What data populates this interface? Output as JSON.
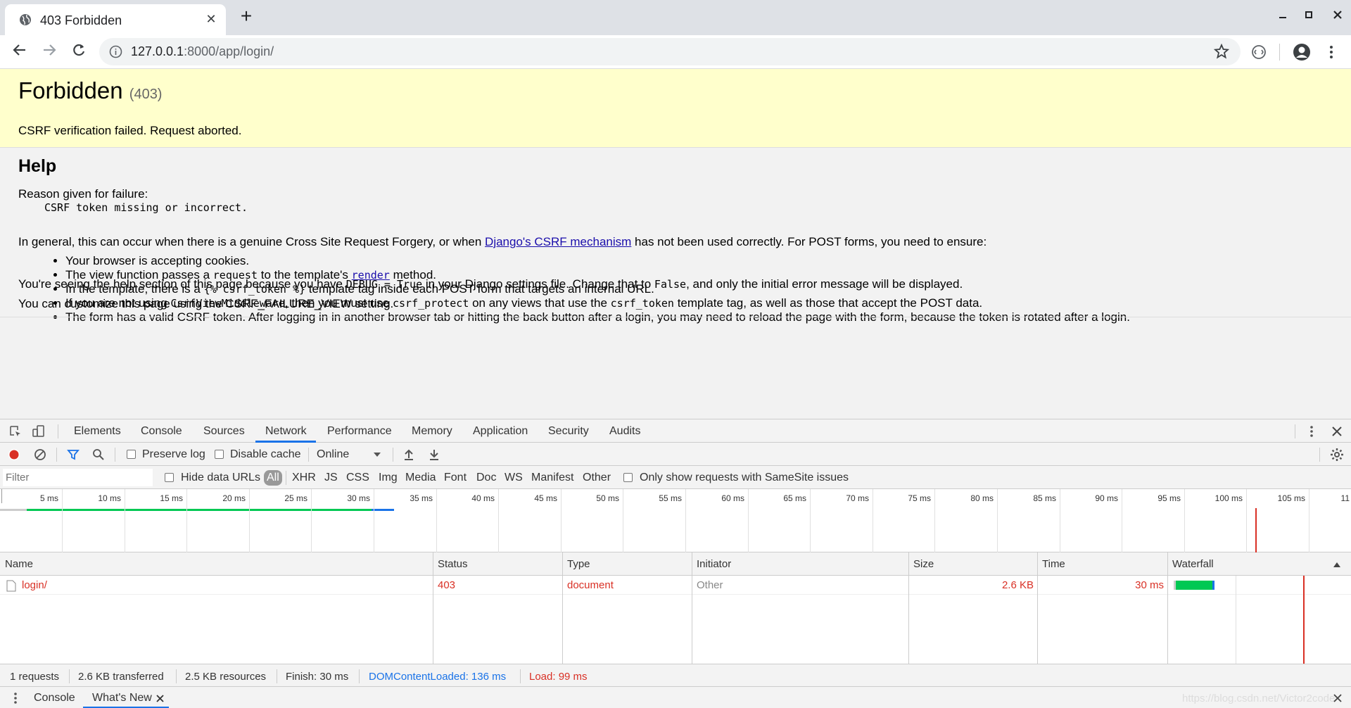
{
  "browser": {
    "tab_title": "403 Forbidden",
    "url_host": "127.0.0.1",
    "url_rest": ":8000/app/login/"
  },
  "page": {
    "title": "Forbidden",
    "code": "(403)",
    "message": "CSRF verification failed. Request aborted.",
    "help_title": "Help",
    "reason_label": "Reason given for failure:",
    "reason": "CSRF token missing or incorrect.",
    "general_pre": "In general, this can occur when there is a genuine Cross Site Request Forgery, or when ",
    "general_link": "Django's CSRF mechanism",
    "general_post": " has not been used correctly. For POST forms, you need to ensure:",
    "bullets": {
      "b1": "Your browser is accepting cookies.",
      "b2_a": "The view function passes a ",
      "b2_code": "request",
      "b2_b": " to the template's ",
      "b2_link": "render",
      "b2_c": " method.",
      "b3_a": "In the template, there is a ",
      "b3_code": "{% csrf_token %}",
      "b3_b": " template tag inside each POST form that targets an internal URL.",
      "b4_a": "If you are not using ",
      "b4_code1": "CsrfViewMiddleware",
      "b4_b": ", then you must use ",
      "b4_code2": "csrf_protect",
      "b4_c": " on any views that use the ",
      "b4_code3": "csrf_token",
      "b4_d": " template tag, as well as those that accept the POST data.",
      "b5": "The form has a valid CSRF token. After logging in in another browser tab or hitting the back button after a login, you may need to reload the page with the form, because the token is rotated after a login."
    },
    "debug_a": "You're seeing the help section of this page because you have ",
    "debug_code1": "DEBUG = True",
    "debug_b": " in your Django settings file. Change that to ",
    "debug_code2": "False",
    "debug_c": ", and only the initial error message will be displayed.",
    "customize": "You can customize this page using the CSRF_FAILURE_VIEW setting."
  },
  "devtools": {
    "tabs": {
      "elements": "Elements",
      "console": "Console",
      "sources": "Sources",
      "network": "Network",
      "performance": "Performance",
      "memory": "Memory",
      "application": "Application",
      "security": "Security",
      "audits": "Audits"
    },
    "toolbar": {
      "preserve_log": "Preserve log",
      "disable_cache": "Disable cache",
      "throttle": "Online"
    },
    "filter": {
      "placeholder": "Filter",
      "hide_data_urls": "Hide data URLs",
      "types": {
        "all": "All",
        "xhr": "XHR",
        "js": "JS",
        "css": "CSS",
        "img": "Img",
        "media": "Media",
        "font": "Font",
        "doc": "Doc",
        "ws": "WS",
        "manifest": "Manifest",
        "other": "Other"
      },
      "samesite": "Only show requests with SameSite issues"
    },
    "timeline_ticks": [
      "5 ms",
      "10 ms",
      "15 ms",
      "20 ms",
      "25 ms",
      "30 ms",
      "35 ms",
      "40 ms",
      "45 ms",
      "50 ms",
      "55 ms",
      "60 ms",
      "65 ms",
      "70 ms",
      "75 ms",
      "80 ms",
      "85 ms",
      "90 ms",
      "95 ms",
      "100 ms",
      "105 ms",
      "11"
    ],
    "columns": {
      "name": "Name",
      "status": "Status",
      "type": "Type",
      "initiator": "Initiator",
      "size": "Size",
      "time": "Time",
      "waterfall": "Waterfall"
    },
    "row": {
      "name": "login/",
      "status": "403",
      "type": "document",
      "initiator": "Other",
      "size": "2.6 KB",
      "time": "30 ms"
    },
    "summary": {
      "requests": "1 requests",
      "transferred": "2.6 KB transferred",
      "resources": "2.5 KB resources",
      "finish": "Finish: 30 ms",
      "dcl": "DOMContentLoaded: 136 ms",
      "load": "Load: 99 ms"
    },
    "drawer": {
      "console": "Console",
      "whats_new": "What's New"
    },
    "watermark": "https://blog.csdn.net/Victor2code"
  },
  "colors": {
    "warning_bg": "#ffffcc",
    "accent_blue": "#1a73e8",
    "error_red": "#d93025",
    "waterfall_green": "#00c853"
  }
}
